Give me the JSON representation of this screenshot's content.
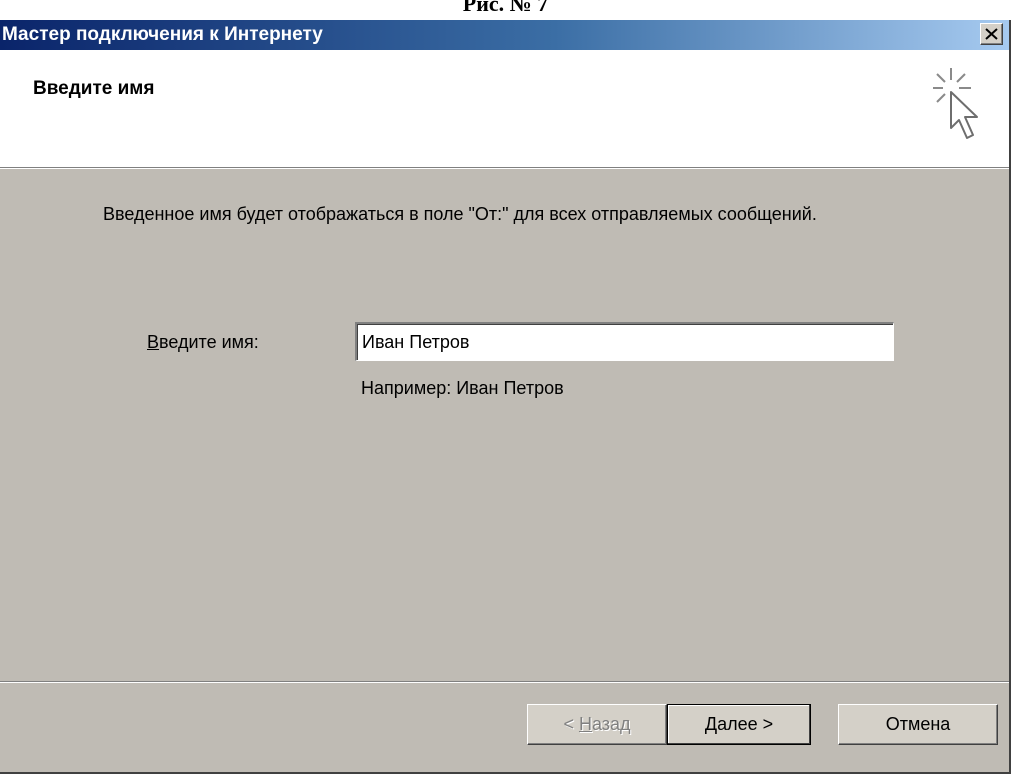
{
  "top_caption": "Рис. № 7",
  "window": {
    "title": "Мастер подключения к Интернету",
    "close_label": "×"
  },
  "header": {
    "title": "Введите имя",
    "icon": "wizard-cursor-icon"
  },
  "body": {
    "description": "Введенное имя будет отображаться в поле \"От:\" для всех отправляемых сообщений.",
    "name_label_hotkey": "В",
    "name_label_rest": "ведите имя:",
    "name_value": "Иван Петров",
    "example": "Например: Иван Петров"
  },
  "buttons": {
    "back_prefix": "< ",
    "back_hotkey": "Н",
    "back_rest": "азад",
    "next": "Далее >",
    "cancel": "Отмена"
  },
  "colors": {
    "dialog_bg": "#bfbbb4",
    "title_gradient_start": "#0a246a",
    "title_gradient_end": "#a6caf0"
  }
}
